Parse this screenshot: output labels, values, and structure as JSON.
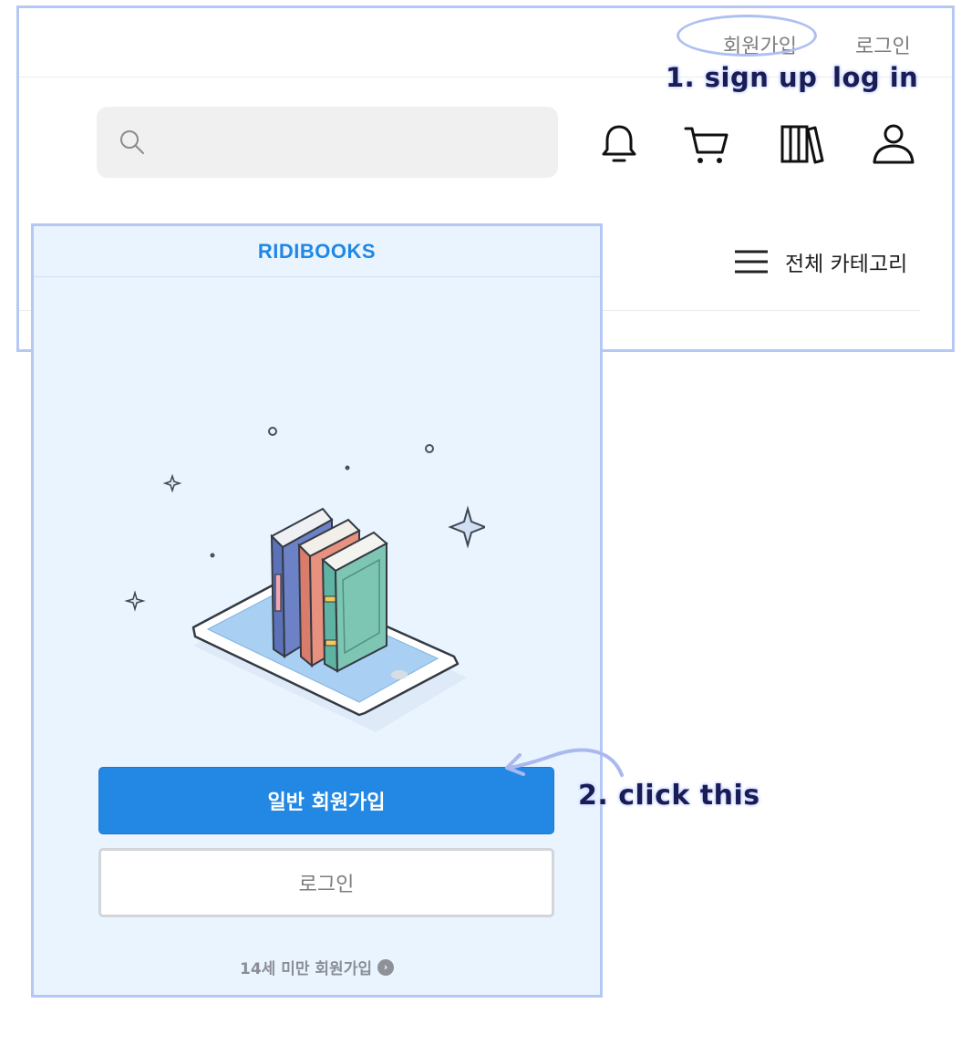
{
  "header": {
    "links": {
      "signup": "회원가입",
      "login": "로그인"
    },
    "search": {
      "placeholder": "",
      "icon": "search-icon"
    },
    "icons": [
      "bell-icon",
      "cart-icon",
      "library-icon",
      "user-icon"
    ],
    "category": {
      "label": "전체 카테고리",
      "icon": "hamburger-menu-icon"
    }
  },
  "panel": {
    "brand": "RIDIBOOKS",
    "primary_button": "일반 회원가입",
    "secondary_button": "로그인",
    "under14_link": "14세 미만 회원가입",
    "illustration": "books-on-phone-illustration"
  },
  "annotations": {
    "step1_signup": "1. sign up",
    "step1_login": "log in",
    "step2": "2. click this"
  },
  "colors": {
    "brand_blue": "#1f87e5",
    "primary_button": "#2388e3",
    "annotation_outline": "#b5c8f5",
    "panel_bg": "#eaf4ff"
  }
}
